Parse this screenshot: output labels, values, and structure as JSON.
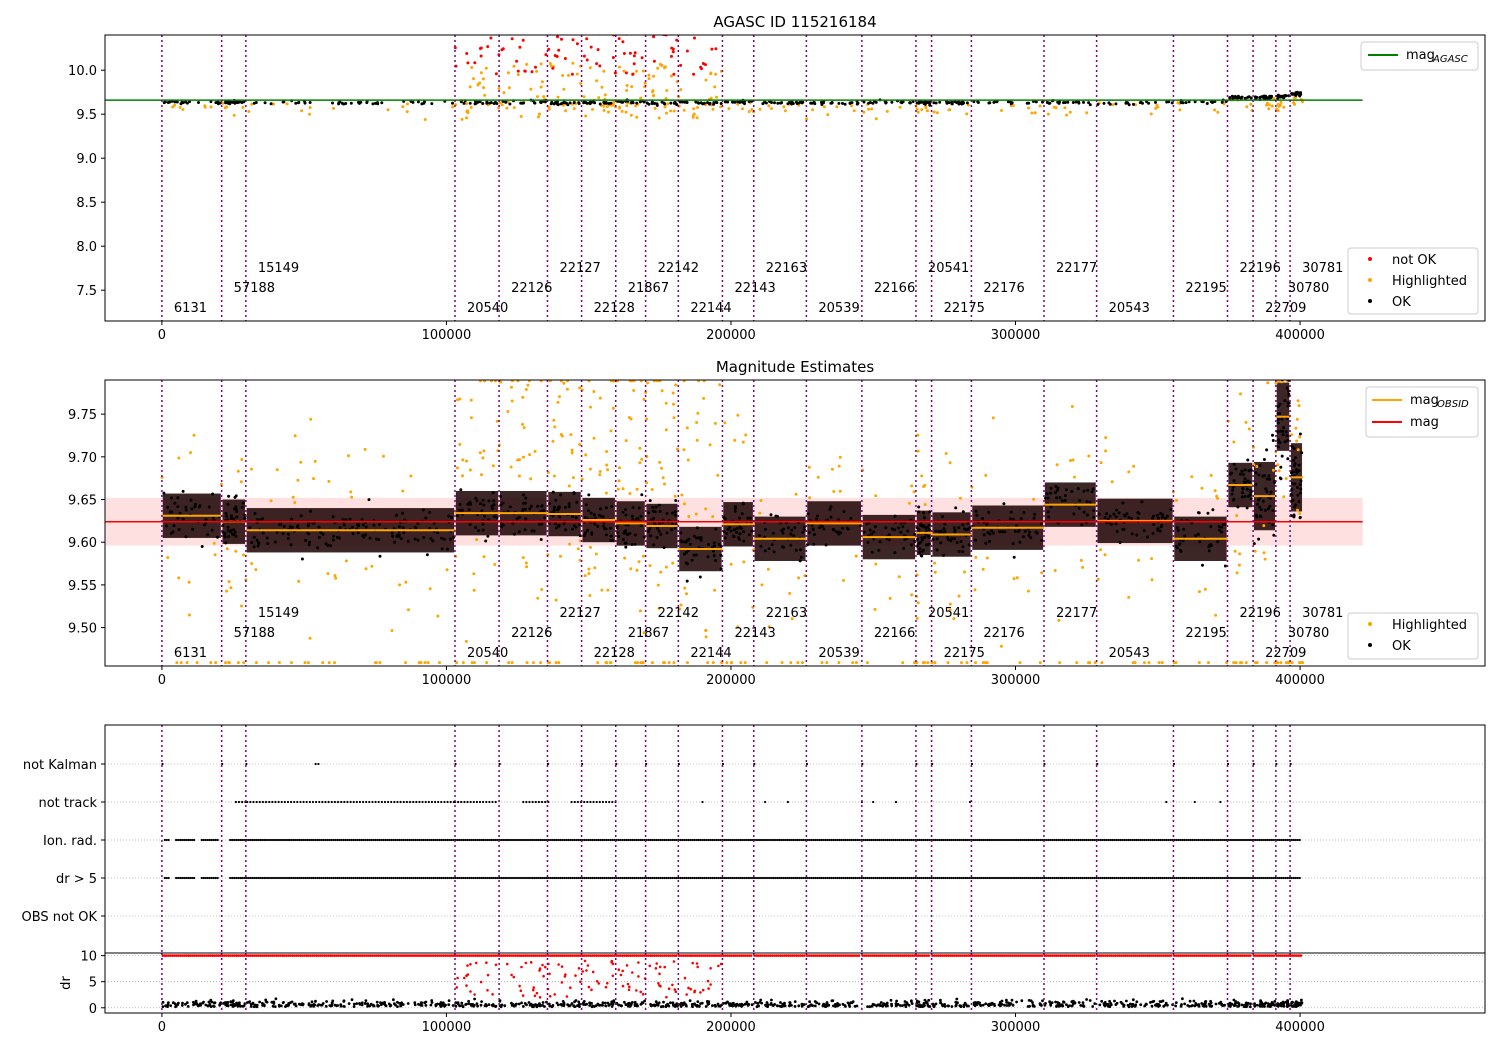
{
  "chart_data": [
    {
      "type": "scatter",
      "title": "AGASC ID 115216184",
      "xlim": [
        -20000,
        465000
      ],
      "ylim": [
        7.15,
        10.4
      ],
      "x_ticks": [
        0,
        100000,
        200000,
        300000,
        400000
      ],
      "y_ticks": [
        7.5,
        8.0,
        8.5,
        9.0,
        9.5,
        10.0
      ],
      "lines": [
        {
          "name": "mag$_{AGASC}$",
          "label_main": "mag",
          "label_sub": "AGASC",
          "color": "#008000",
          "y": 9.66,
          "x_range": [
            -20000,
            422000
          ]
        }
      ],
      "series": [
        {
          "name": "not OK",
          "color": "#ff0000"
        },
        {
          "name": "Highlighted",
          "color": "#ffa500"
        },
        {
          "name": "OK",
          "color": "#000000"
        }
      ],
      "legends": [
        "top-right",
        "bottom-right"
      ],
      "grid": false
    },
    {
      "type": "scatter",
      "title": "Magnitude Estimates",
      "xlim": [
        -20000,
        465000
      ],
      "ylim": [
        9.455,
        9.79
      ],
      "x_ticks": [
        0,
        100000,
        200000,
        300000,
        400000
      ],
      "y_ticks": [
        9.5,
        9.55,
        9.6,
        9.65,
        9.7,
        9.75
      ],
      "lines": [
        {
          "name": "mag$_{OBSID}$",
          "label_main": "mag",
          "label_sub": "OBSID",
          "color": "#ffa500"
        },
        {
          "name": "mag",
          "label_main": "mag",
          "label_sub": "",
          "color": "#ff0000",
          "y": 9.624,
          "band": [
            9.596,
            9.652
          ]
        }
      ],
      "obsid_means": [
        9.631,
        9.624,
        9.614,
        9.634,
        9.634,
        9.633,
        9.626,
        9.622,
        9.619,
        9.592,
        9.621,
        9.604,
        9.622,
        9.606,
        9.611,
        9.609,
        9.617,
        9.644,
        9.625,
        9.604,
        9.667,
        9.654,
        9.747,
        9.676
      ],
      "series": [
        {
          "name": "Highlighted",
          "color": "#ffa500"
        },
        {
          "name": "OK",
          "color": "#000000"
        }
      ],
      "legends": [
        "top-right",
        "bottom-right"
      ],
      "grid": false
    },
    {
      "type": "scatter",
      "title": "",
      "xlim": [
        -20000,
        465000
      ],
      "categories": [
        "not Kalman",
        "not track",
        "Ion. rad.",
        "dr > 5",
        "OBS not OK"
      ],
      "grid": true
    },
    {
      "type": "scatter",
      "title": "",
      "ylabel": "dr",
      "xlim": [
        -20000,
        465000
      ],
      "ylim": [
        -1,
        10.5
      ],
      "x_ticks": [
        0,
        100000,
        200000,
        300000,
        400000
      ],
      "y_ticks": [
        0,
        5,
        10
      ],
      "series": [
        {
          "name": "OK",
          "color": "#000000"
        },
        {
          "name": "not OK",
          "color": "#ff0000"
        }
      ],
      "grid": true
    }
  ],
  "observations": [
    {
      "obsid": "6131",
      "start": 0,
      "row": 2
    },
    {
      "obsid": "57188",
      "start": 21000,
      "row": 1
    },
    {
      "obsid": "15149",
      "start": 29500,
      "row": 0
    },
    {
      "obsid": "20540",
      "start": 103000,
      "row": 2
    },
    {
      "obsid": "22126",
      "start": 118500,
      "row": 1
    },
    {
      "obsid": "22127",
      "start": 135500,
      "row": 0
    },
    {
      "obsid": "22128",
      "start": 147500,
      "row": 2
    },
    {
      "obsid": "21867",
      "start": 159500,
      "row": 1
    },
    {
      "obsid": "22142",
      "start": 170000,
      "row": 0
    },
    {
      "obsid": "22144",
      "start": 181500,
      "row": 2
    },
    {
      "obsid": "22143",
      "start": 197000,
      "row": 1
    },
    {
      "obsid": "22163",
      "start": 208000,
      "row": 0
    },
    {
      "obsid": "20539",
      "start": 226500,
      "row": 2
    },
    {
      "obsid": "22166",
      "start": 246000,
      "row": 1
    },
    {
      "obsid": "20541",
      "start": 265000,
      "row": 0
    },
    {
      "obsid": "22175",
      "start": 270500,
      "row": 2
    },
    {
      "obsid": "22176",
      "start": 284500,
      "row": 1
    },
    {
      "obsid": "22177",
      "start": 310000,
      "row": 0
    },
    {
      "obsid": "20543",
      "start": 328500,
      "row": 2
    },
    {
      "obsid": "22195",
      "start": 355500,
      "row": 1
    },
    {
      "obsid": "22196",
      "start": 374500,
      "row": 0
    },
    {
      "obsid": "22709",
      "start": 383500,
      "row": 2
    },
    {
      "obsid": "30780",
      "start": 391500,
      "row": 1
    },
    {
      "obsid": "30781",
      "start": 396500,
      "row": 0
    }
  ],
  "end_time": 401000,
  "legend_labels": {
    "not_ok": "not OK",
    "highlighted": "Highlighted",
    "ok": "OK",
    "mag": "mag"
  },
  "colors": {
    "ok": "#000000",
    "highlighted": "#ffa500",
    "not_ok": "#ff0000",
    "agasc_line": "#008000",
    "obsid_line": "#ffa500",
    "mag_line": "#ff0000",
    "obs_boundary": "#800080"
  }
}
